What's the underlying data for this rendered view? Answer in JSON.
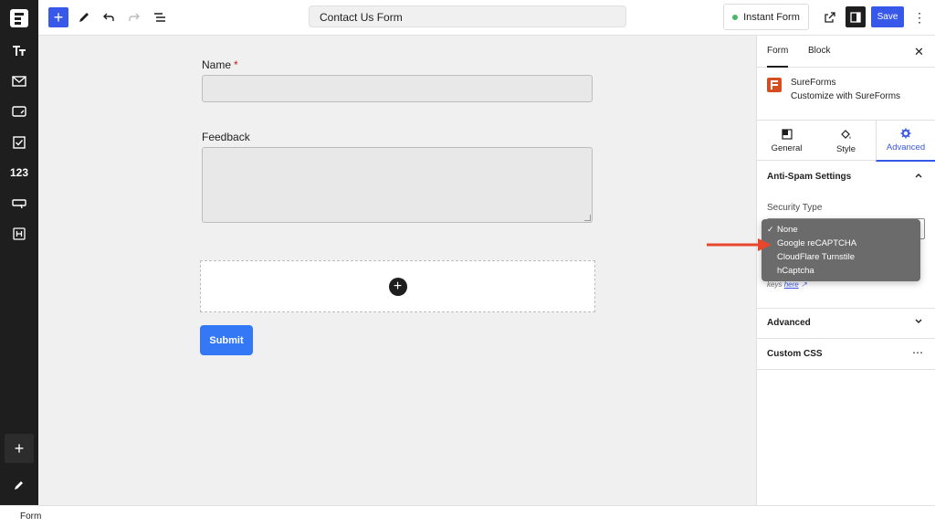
{
  "topbar": {
    "doc_title": "Contact Us Form",
    "instant_label": "Instant Form",
    "save_label": "Save"
  },
  "rail": {
    "items": [
      "typography",
      "mail",
      "phone-input",
      "checkbox",
      "123",
      "button",
      "heading"
    ],
    "number_label": "123"
  },
  "form": {
    "name_label": "Name",
    "name_required_mark": "*",
    "feedback_label": "Feedback",
    "submit_label": "Submit"
  },
  "sidebar": {
    "tabs": [
      "Form",
      "Block"
    ],
    "plugin_name": "SureForms",
    "plugin_desc": "Customize with SureForms",
    "sub_tabs": [
      "General",
      "Style",
      "Advanced"
    ],
    "anti_spam_title": "Anti-Spam Settings",
    "security_type_label": "Security Type",
    "help_prefix": "keys",
    "help_link": "here",
    "advanced_title": "Advanced",
    "custom_css_title": "Custom CSS"
  },
  "dropdown": {
    "options": [
      "None",
      "Google reCAPTCHA",
      "CloudFlare Turnstile",
      "hCaptcha"
    ],
    "selected": "None"
  },
  "statusbar": {
    "crumb": "Form"
  },
  "colors": {
    "accent": "#3858e9",
    "submit": "#3478f6",
    "arrow": "#e8472d",
    "brand": "#d54e21"
  }
}
